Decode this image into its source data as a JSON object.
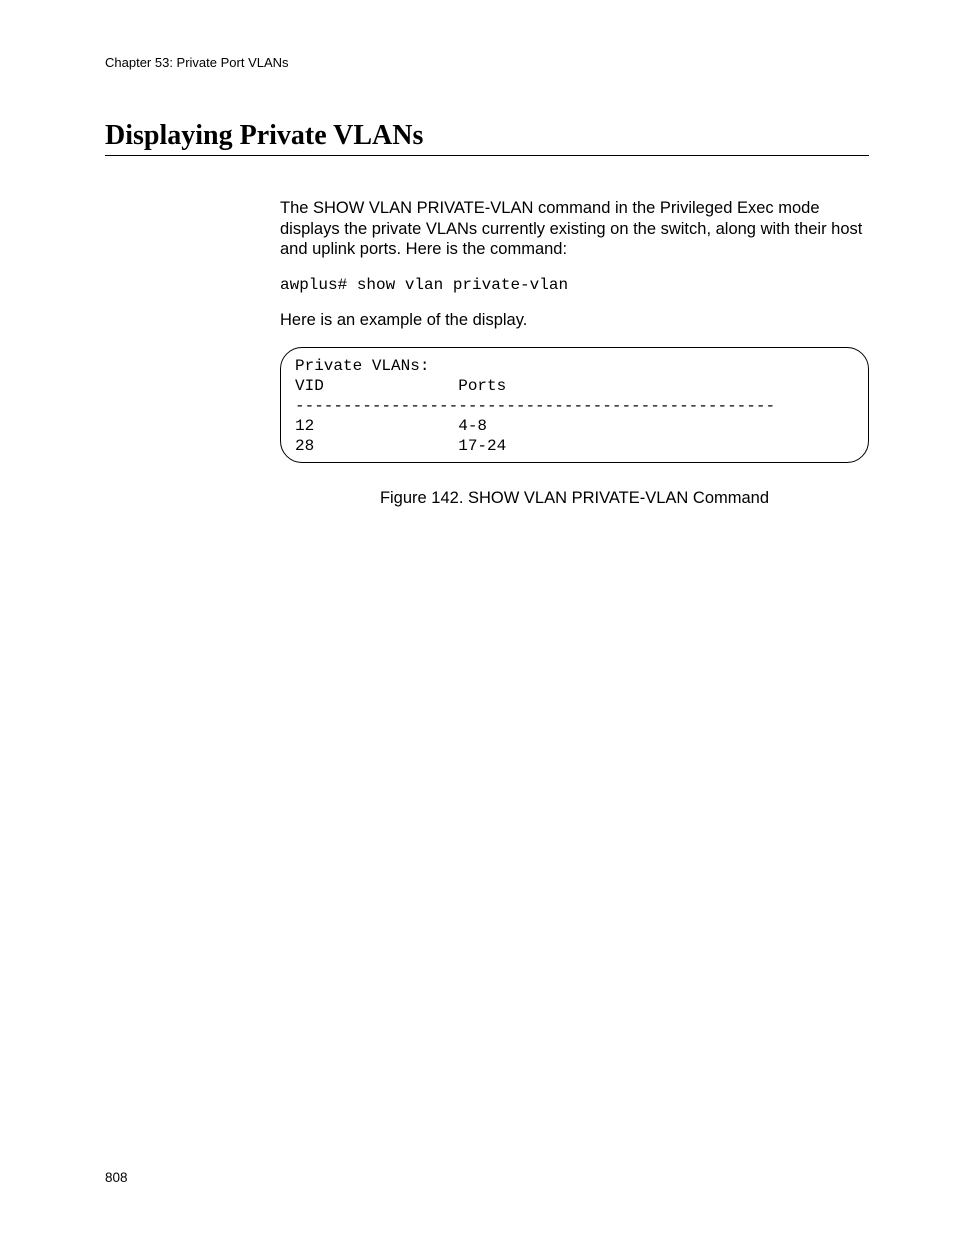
{
  "header": {
    "chapter": "Chapter 53: Private Port VLANs"
  },
  "section": {
    "title": "Displaying Private VLANs"
  },
  "body": {
    "paragraph1": "The SHOW VLAN PRIVATE-VLAN command in the Privileged Exec mode displays the private VLANs currently existing on the switch, along with their host and uplink ports. Here is the command:",
    "command": "awplus# show vlan private-vlan",
    "paragraph2": "Here is an example of the display.",
    "output": "Private VLANs:\nVID              Ports\n--------------------------------------------------\n12               4-8\n28               17-24",
    "figure_caption": "Figure 142. SHOW VLAN PRIVATE-VLAN Command"
  },
  "footer": {
    "page_number": "808"
  }
}
